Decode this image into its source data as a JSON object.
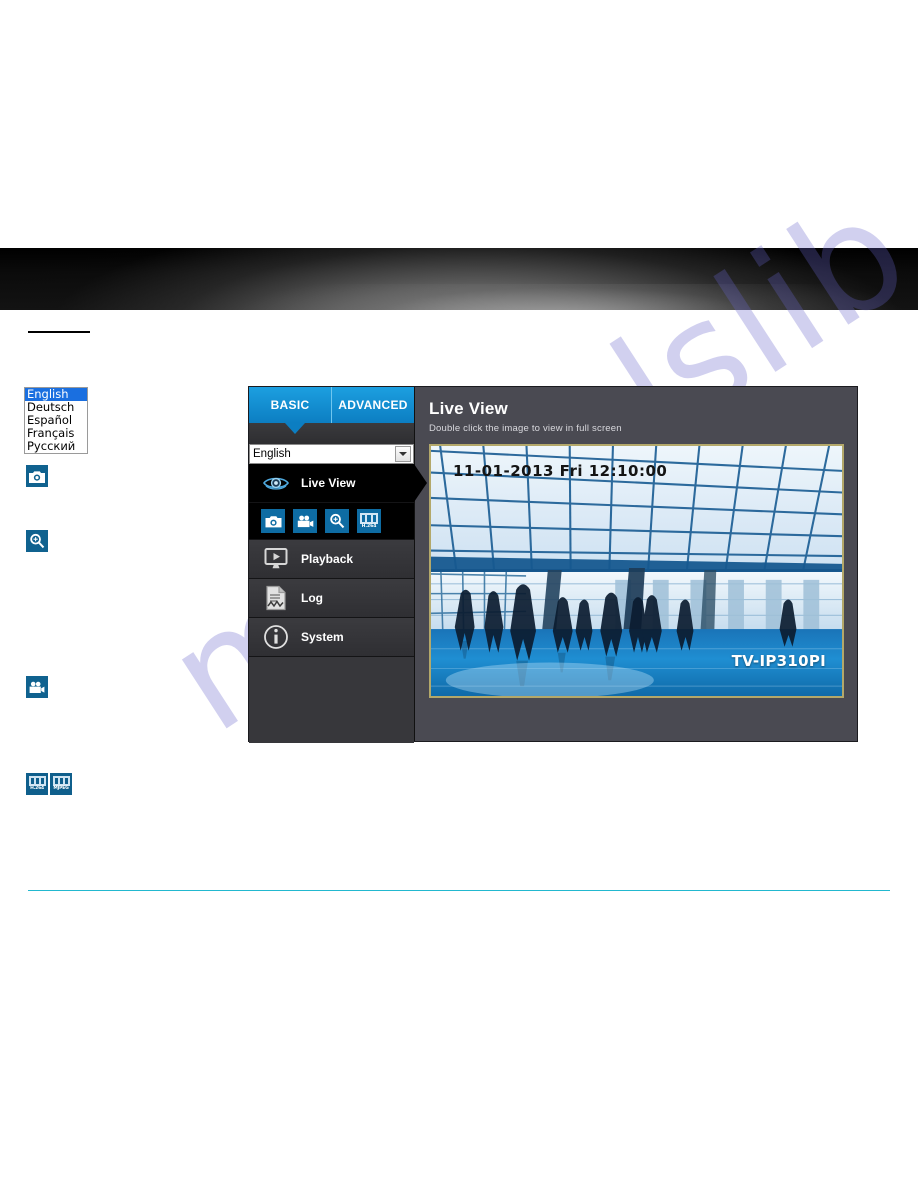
{
  "watermark": {
    "text": "manualslib.com"
  },
  "header": {
    "banner_label": ""
  },
  "language_list": {
    "options": [
      "English",
      "Deutsch",
      "Español",
      "Français",
      "Русский"
    ],
    "selected": "English"
  },
  "margin_icons": [
    {
      "name": "snapshot-icon",
      "label": ""
    },
    {
      "name": "zoom-icon",
      "label": ""
    },
    {
      "name": "record-icon",
      "label": ""
    },
    {
      "name": "h264-icon",
      "label": "H.264"
    },
    {
      "name": "mjpeg-icon",
      "label": "MJPEG"
    }
  ],
  "camera_ui": {
    "tabs": [
      {
        "id": "basic",
        "label": "BASIC",
        "active": true
      },
      {
        "id": "advanced",
        "label": "ADVANCED",
        "active": false
      }
    ],
    "language_select": {
      "value": "English",
      "options": [
        "English",
        "Deutsch",
        "Español",
        "Français",
        "Русский"
      ]
    },
    "nav": [
      {
        "id": "live-view",
        "label": "Live View",
        "icon": "eye-icon",
        "active": true
      },
      {
        "id": "playback",
        "label": "Playback",
        "icon": "playback-monitor-icon",
        "active": false
      },
      {
        "id": "log",
        "label": "Log",
        "icon": "log-document-icon",
        "active": false
      },
      {
        "id": "system",
        "label": "System",
        "icon": "info-circle-icon",
        "active": false
      }
    ],
    "live_view_tools": [
      {
        "id": "snapshot",
        "icon": "camera-icon",
        "label": ""
      },
      {
        "id": "record",
        "icon": "video-camera-icon",
        "label": ""
      },
      {
        "id": "zoom",
        "icon": "magnifier-icon",
        "label": ""
      },
      {
        "id": "codec",
        "icon": "film-strip-icon",
        "label": "H.264"
      }
    ],
    "content": {
      "title": "Live View",
      "subtitle": "Double click the image to view in full screen",
      "video": {
        "osd_timestamp": "11-01-2013 Fri 12:10:00",
        "osd_camera_name": "TV-IP310PI"
      }
    }
  },
  "colors": {
    "tab_blue": "#0c7ec2",
    "icon_blue": "#0e6ca3",
    "panel_gray": "#4a4a52",
    "sidebar_dark": "#2b2b2e",
    "divider_cyan": "#22b8cf",
    "video_border": "#b3a86a"
  }
}
